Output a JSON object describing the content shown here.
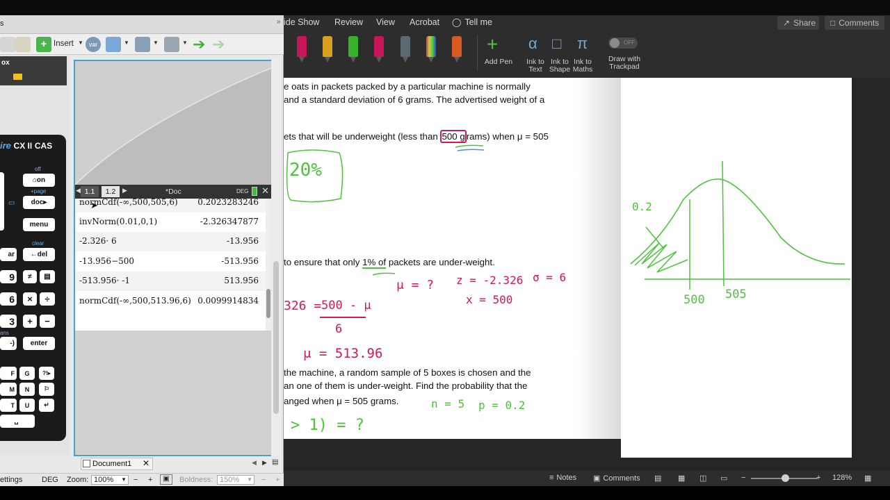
{
  "ppt": {
    "tabs": [
      "ide Show",
      "Review",
      "View",
      "Acrobat",
      "Tell me"
    ],
    "share_label": "Share",
    "comments_label": "Comments",
    "ribbon": {
      "pen_colors": [
        "#c8165a",
        "#d9a020",
        "#38b02a",
        "#c8165a",
        "#5a6a70",
        "#9a6ad0",
        "#d85a20"
      ],
      "add_pen_label": "Add Pen",
      "ink_to_text_label": "Ink to\nText",
      "ink_to_shape_label": "Ink to\nShape",
      "ink_to_maths_label": "Ink to\nMaths",
      "draw_with_trackpad_label": "Draw with\nTrackpad",
      "toggle_text": "OFF"
    },
    "slide": {
      "line1": "e oats in packets packed by a particular machine is normally",
      "line2": "and a standard deviation of 6 grams. The advertised weight of a",
      "line3_pre": "ets that will be underweight (less than ",
      "line3_num": "500 g",
      "line3_post": "rams) when μ = 505",
      "line4_pre": " to ensure that only ",
      "line4_pct": "1% of",
      "line4_post": " packets are under-weight.",
      "line5": "the machine, a random sample of 5 boxes is chosen and the",
      "line6": "an one of them is under-weight. Find the probability that the",
      "line7": "anged when μ = 505 grams.",
      "hw_20pct": "20%",
      "hw_mu_q": "μ = ?",
      "hw_z": "z = -2.326",
      "hw_sigma": "σ = 6",
      "hw_x": "x = 500",
      "hw_eq_left": "326 =",
      "hw_eq_num": "500 - μ",
      "hw_eq_den": "6",
      "hw_mu_val": "μ = 513.96",
      "hw_prob": "> 1) = ?",
      "hw_n": "n = 5",
      "hw_p": "p = 0.2",
      "hw_02": "0.2",
      "hw_500": "500",
      "hw_505": "505"
    },
    "status": {
      "notes_label": "Notes",
      "comments_label": "Comments",
      "zoom_pct": "128%"
    }
  },
  "ti": {
    "toolbar": {
      "left_frag": "s",
      "insert_label": "Insert"
    },
    "toolbox_label": "ox",
    "calc_brand": "ire",
    "calc_model": "CX II",
    "calc_cas": "CAS",
    "keys": {
      "off": "off",
      "on": "on",
      "page": "+page",
      "doc": "doc",
      "menu": "menu",
      "clear": "clear",
      "del": "del",
      "var": "ar",
      "n9": "9",
      "n6": "6",
      "n3": "3",
      "neg": "-)",
      "mul": "×",
      "div": "÷",
      "add": "+",
      "sub": "−",
      "enter": "enter",
      "ans": "ans",
      "F": "F",
      "G": "G",
      "M": "M",
      "N": "N",
      "T": "T",
      "U": "U"
    },
    "doc_bar": {
      "tab1": "1.1",
      "tab2": "1.2",
      "doc_name": "*Doc",
      "mode": "DEG"
    },
    "calc_rows": [
      {
        "expr": "normCdf(-∞,500,505,6)",
        "res": "0.2023283246"
      },
      {
        "expr": "invNorm(0.01,0,1)",
        "res": "-2.326347877"
      },
      {
        "expr": "-2.326· 6",
        "res": "-13.956"
      },
      {
        "expr": "-13.956−500",
        "res": "-513.956"
      },
      {
        "expr": "-513.956· -1",
        "res": "513.956"
      },
      {
        "expr": "normCdf(-∞,500,513.96,6)",
        "res": "0.0099914834"
      }
    ],
    "doc_tab_label": "Document1",
    "status": {
      "settings": "ettings",
      "mode": "DEG",
      "zoom_label": "Zoom:",
      "zoom_val": "100%",
      "boldness_label": "Boldness:",
      "boldness_val": "150%"
    }
  }
}
